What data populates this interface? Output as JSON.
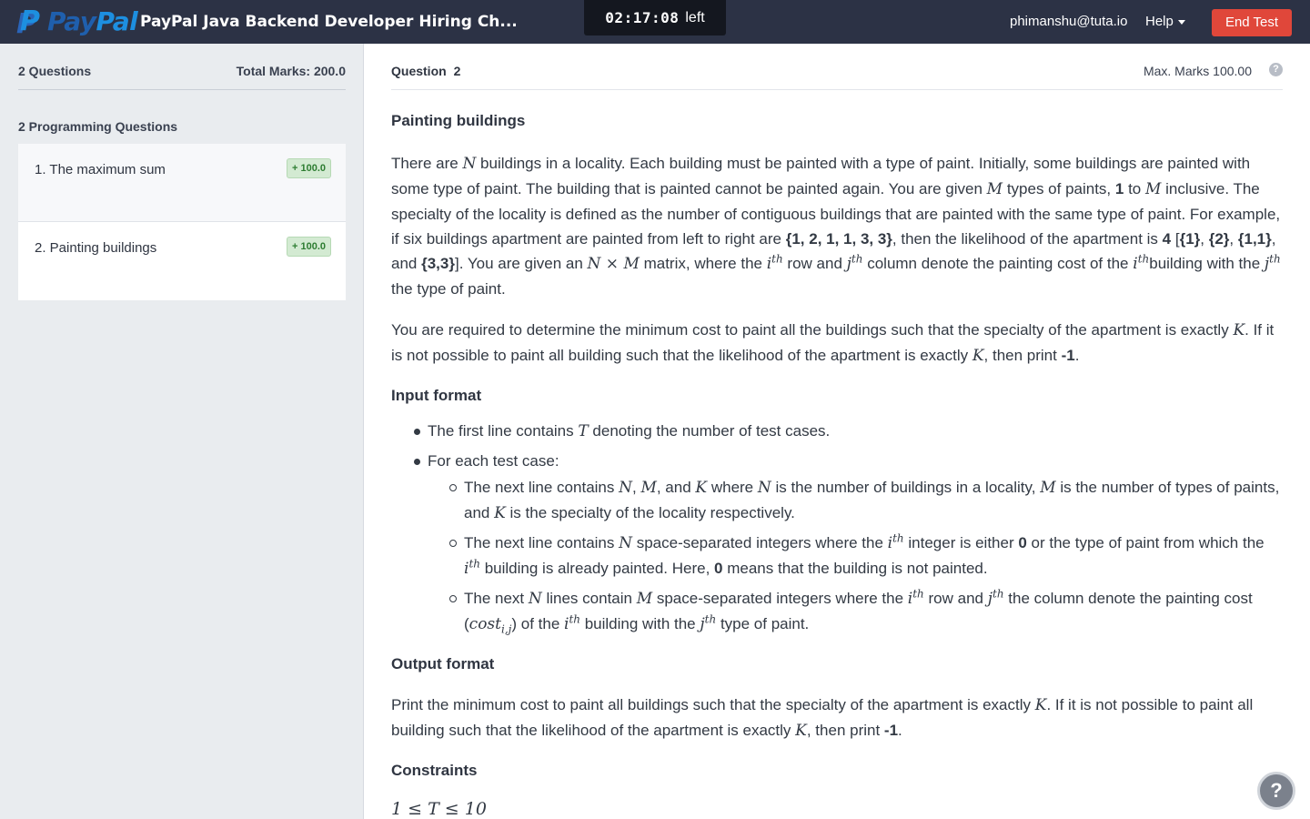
{
  "header": {
    "logo_text_pay": "Pay",
    "logo_text_pal": "Pal",
    "test_title": "PayPal Java Backend Developer Hiring Ch...",
    "timer_value": "02:17:08",
    "timer_label": "left",
    "user_email": "phimanshu@tuta.io",
    "help_label": "Help",
    "end_test_label": "End Test"
  },
  "sidebar": {
    "question_count": "2 Questions",
    "total_marks": "Total Marks: 200.0",
    "section_title": "2 Programming Questions",
    "questions": [
      {
        "title": "1. The maximum sum",
        "marks": "+ 100.0"
      },
      {
        "title": "2. Painting buildings",
        "marks": "+ 100.0"
      }
    ]
  },
  "question": {
    "label": "Question",
    "number": "2",
    "max_marks": "Max. Marks 100.00",
    "help_icon": "?",
    "title": "Painting buildings",
    "sections": {
      "input_format": "Input format",
      "output_format": "Output format",
      "constraints": "Constraints"
    },
    "constraint_1": "1 ≤ T ≤ 10"
  },
  "colors": {
    "topbar": "#2c3245",
    "end_test": "#e0473a",
    "sidebar_bg": "#e9ecef",
    "badge_bg": "#d3ead2"
  },
  "icons": {
    "help_caret": "chevron-down-icon",
    "float_help": "question-circle-icon"
  }
}
